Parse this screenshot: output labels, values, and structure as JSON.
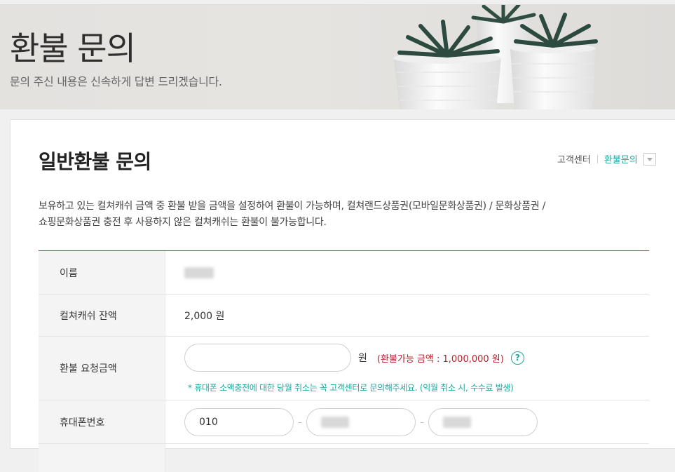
{
  "hero": {
    "title": "환불 문의",
    "subtitle": "문의 주신 내용은 신속하게 답변 드리겠습니다."
  },
  "section": {
    "title": "일반환불 문의",
    "breadcrumb": [
      "고객센터",
      "환불문의"
    ],
    "description_line1": "보유하고 있는 컬쳐캐쉬 금액 중 환불 받을 금액을 설정하여 환불이 가능하며, 컬쳐랜드상품권(모바일문화상품권) / 문화상품권 /",
    "description_line2": "쇼핑문화상품권 충전 후 사용하지 않은 컬쳐캐쉬는 환불이 불가능합니다."
  },
  "form": {
    "name_label": "이름",
    "balance_label": "컬쳐캐쉬 잔액",
    "balance_value": "2,000 원",
    "amount_label": "환불 요청금액",
    "amount_value": "",
    "amount_unit": "원",
    "refundable_note": "(환불가능 금액 : 1,000,000 원)",
    "help_glyph": "?",
    "notice": "* 휴대폰 소액충전에 대한 당월 취소는 꼭 고객센터로 문의해주세요. (익월 취소 시, 수수료 발생)",
    "phone_label": "휴대폰번호",
    "phone_part1": "010",
    "phone_separator": "–"
  },
  "colors": {
    "accent": "#1fa6a0",
    "alert": "#b8202e",
    "form_top_border": "#b8344a"
  },
  "icons": {
    "help": "question-circle-icon",
    "dropdown": "chevron-down-icon",
    "hero_image": "succulent-plants-image"
  }
}
